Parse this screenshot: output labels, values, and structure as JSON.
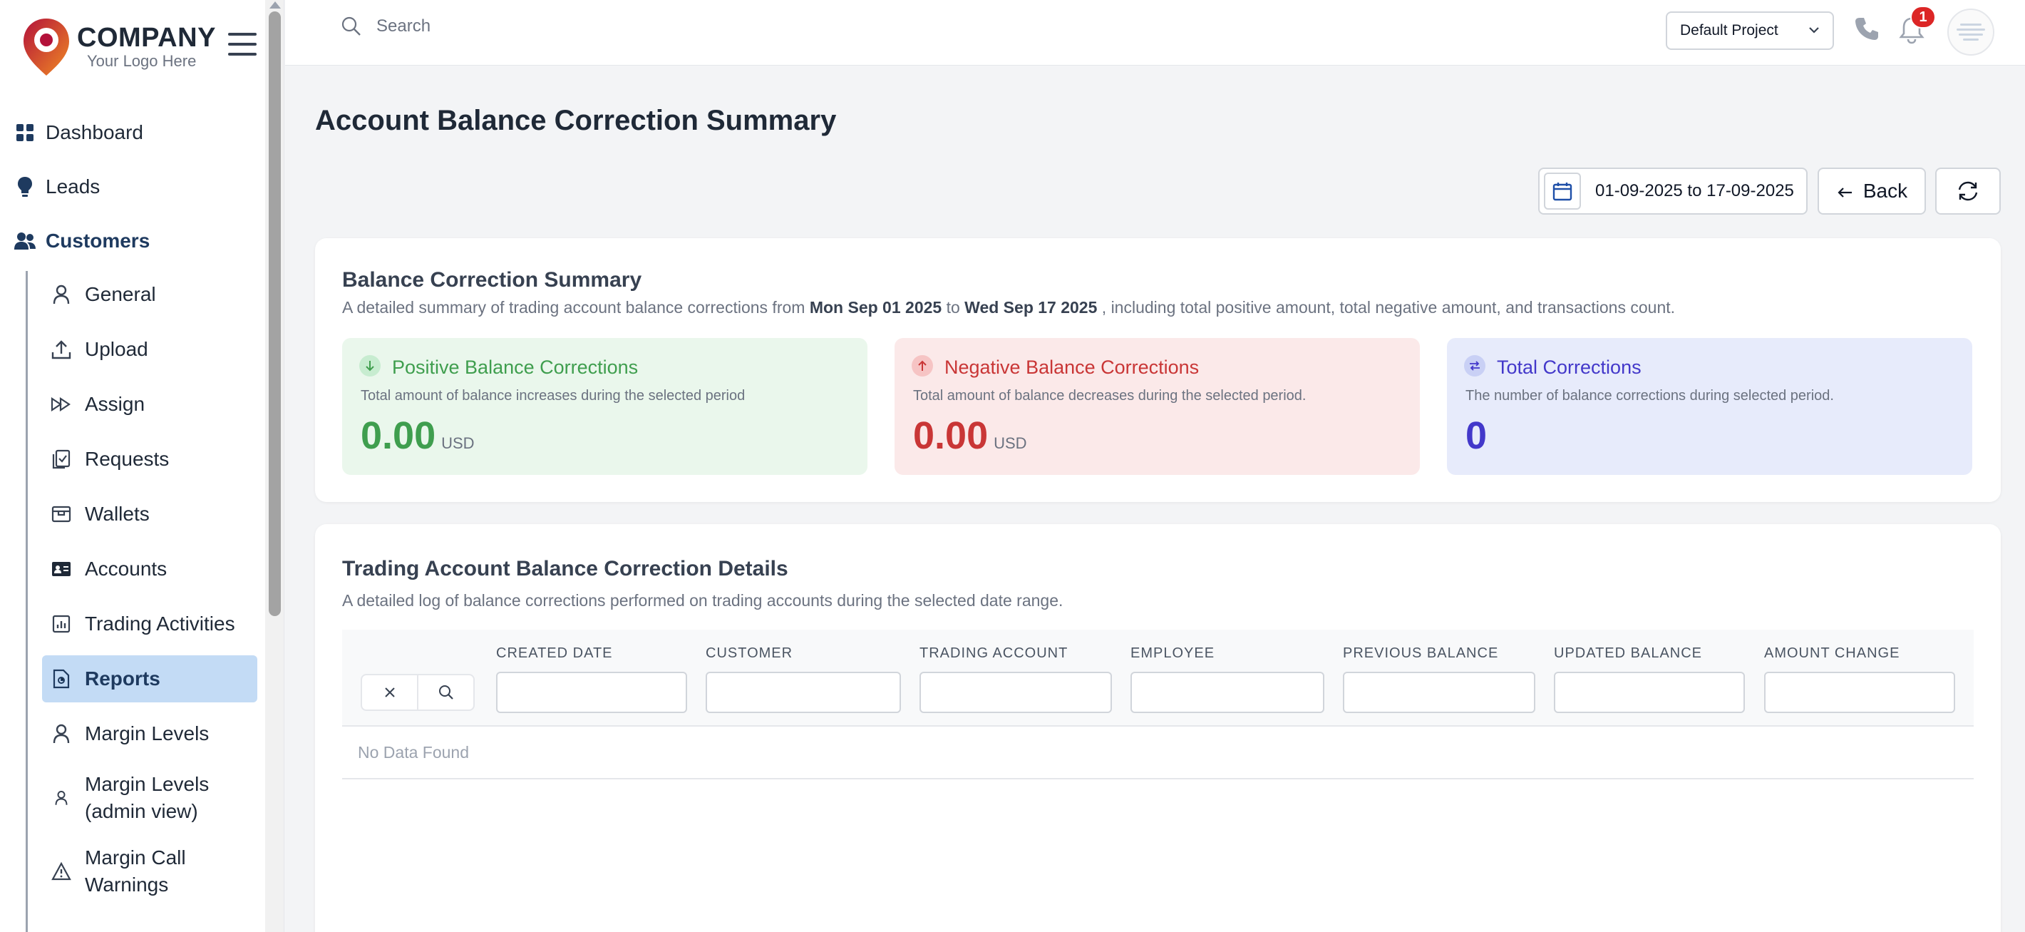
{
  "brand": {
    "company": "COMPANY",
    "tagline": "Your Logo Here"
  },
  "nav": {
    "dashboard": "Dashboard",
    "leads": "Leads",
    "customers": "Customers"
  },
  "subnav": [
    {
      "label": "General"
    },
    {
      "label": "Upload"
    },
    {
      "label": "Assign"
    },
    {
      "label": "Requests"
    },
    {
      "label": "Wallets"
    },
    {
      "label": "Accounts"
    },
    {
      "label": "Trading Activities"
    },
    {
      "label": "Reports"
    },
    {
      "label": "Margin Levels"
    },
    {
      "label": "Margin Levels (admin view)"
    },
    {
      "label": "Margin Call Warnings"
    }
  ],
  "topbar": {
    "search_placeholder": "Search",
    "project": "Default Project",
    "notification_count": "1"
  },
  "page": {
    "title": "Account Balance Correction Summary",
    "date_range": "01-09-2025 to 17-09-2025",
    "back_label": "Back"
  },
  "summary": {
    "title": "Balance Correction Summary",
    "desc_prefix": "A detailed summary of trading account balance corrections from",
    "date_from": "Mon Sep 01 2025",
    "desc_to": "to",
    "date_to": "Wed Sep 17 2025",
    "desc_suffix": ", including total positive amount, total negative amount, and transactions count.",
    "positive": {
      "title": "Positive Balance Corrections",
      "desc": "Total amount of balance increases during the selected period",
      "value": "0.00",
      "unit": "USD"
    },
    "negative": {
      "title": "Negative Balance Corrections",
      "desc": "Total amount of balance decreases during the selected period.",
      "value": "0.00",
      "unit": "USD"
    },
    "total": {
      "title": "Total Corrections",
      "desc": "The number of balance corrections during selected period.",
      "value": "0"
    }
  },
  "details": {
    "title": "Trading Account Balance Correction Details",
    "desc": "A detailed log of balance corrections performed on trading accounts during the selected date range.",
    "columns": [
      "CREATED DATE",
      "CUSTOMER",
      "TRADING ACCOUNT",
      "EMPLOYEE",
      "PREVIOUS BALANCE",
      "UPDATED BALANCE",
      "AMOUNT CHANGE"
    ],
    "empty": "No Data Found"
  },
  "colors": {
    "positive": "#3f9e4e",
    "negative": "#c93636",
    "total": "#4338ca",
    "active_nav_bg": "#c3dbf5",
    "badge": "#dc2626"
  }
}
